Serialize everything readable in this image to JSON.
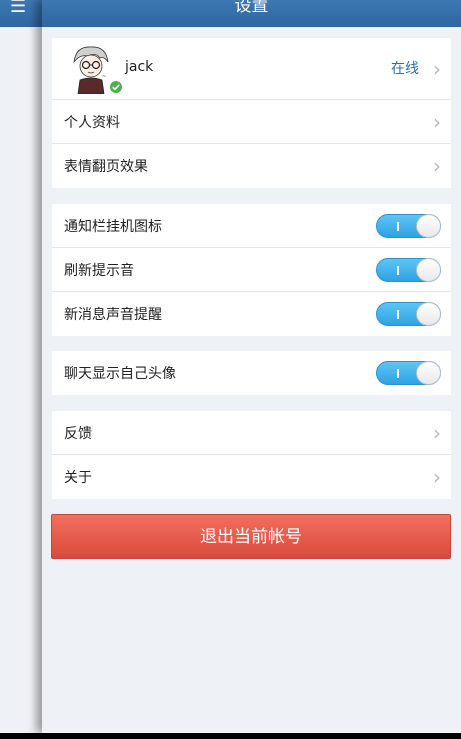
{
  "nav": {
    "title": "设置"
  },
  "profile": {
    "username": "jack",
    "status": "在线"
  },
  "group1": [
    "个人资料",
    "表情翻页效果"
  ],
  "group2": [
    "通知栏挂机图标",
    "刷新提示音",
    "新消息声音提醒"
  ],
  "group3": [
    "聊天显示自己头像"
  ],
  "group4": [
    "反馈",
    "关于"
  ],
  "logout": {
    "label": "退出当前帐号"
  },
  "toggles": {
    "notify_icon": true,
    "refresh_sound": true,
    "message_sound": true,
    "show_own_avatar": true
  },
  "colors": {
    "navbar": "#3572ab",
    "accent": "#2f6db4",
    "toggle_on": "#3fb1ea",
    "logout": "#e55a4a",
    "background": "#eef1f6"
  },
  "icons": {
    "menu": "menu-icon",
    "chevron": "chevron-right-icon",
    "online_badge": "check-badge-icon"
  }
}
